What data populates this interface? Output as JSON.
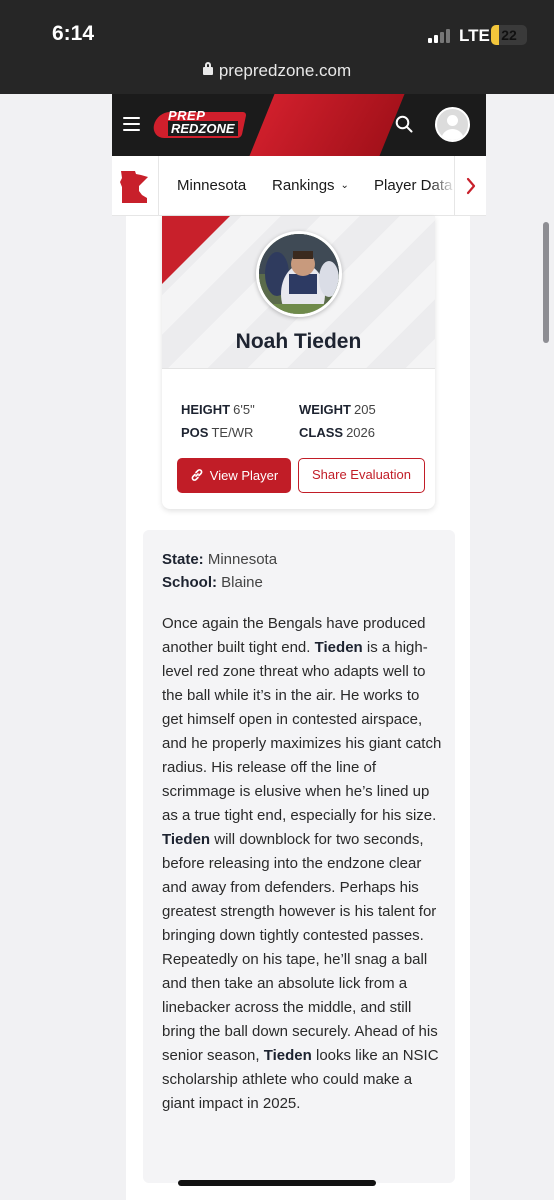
{
  "status_bar": {
    "time": "6:14",
    "network": "LTE",
    "battery": "22",
    "battery_level": 0.22
  },
  "browser": {
    "url": "prepredzone.com"
  },
  "site_header": {
    "logo_line1": "PREP",
    "logo_line2": "REDZONE",
    "menu_icon": "hamburger-icon",
    "search_icon": "search-icon",
    "profile_icon": "user-avatar-icon"
  },
  "subnav": {
    "state_icon": "minnesota-state-icon",
    "items": [
      {
        "label": "Minnesota"
      },
      {
        "label": "Rankings",
        "has_dropdown": true
      },
      {
        "label": "Player Data"
      }
    ],
    "next_icon": "chevron-right-icon"
  },
  "player": {
    "name": "Noah Tieden",
    "height_label": "HEIGHT",
    "height": "6'5\"",
    "weight_label": "WEIGHT",
    "weight": "205",
    "pos_label": "POS",
    "pos": "TE/WR",
    "class_label": "CLASS",
    "class": "2026",
    "view_button": "View Player",
    "share_button": "Share Evaluation"
  },
  "details": {
    "state_label": "State:",
    "state": "Minnesota",
    "school_label": "School:",
    "school": "Blaine"
  },
  "article": {
    "p1": "Once again the Bengals have produced another built tight end.",
    "n1": "Tieden",
    "p2": "is a high-level red zone threat who adapts well to the ball while it’s in the air. He works to get himself open in contested airspace, and he properly maximizes his giant catch radius. His release off the line of scrimmage is elusive when he’s lined up as a true tight end, especially for his size.",
    "n2": "Tieden",
    "p3": "will downblock for two seconds, before releasing into the endzone clear and away from defenders. Perhaps his greatest strength however is his talent for bringing down tightly contested passes. Repeatedly on his tape, he’ll snag a ball and then take an absolute lick from a linebacker across the middle, and still bring the ball down securely. Ahead of his senior season,",
    "n3": "Tieden",
    "p4": "looks like an NSIC scholarship athlete who could make a giant impact in 2025."
  },
  "colors": {
    "brand_red": "#c11d27",
    "header_dark": "#1b1b1b"
  }
}
